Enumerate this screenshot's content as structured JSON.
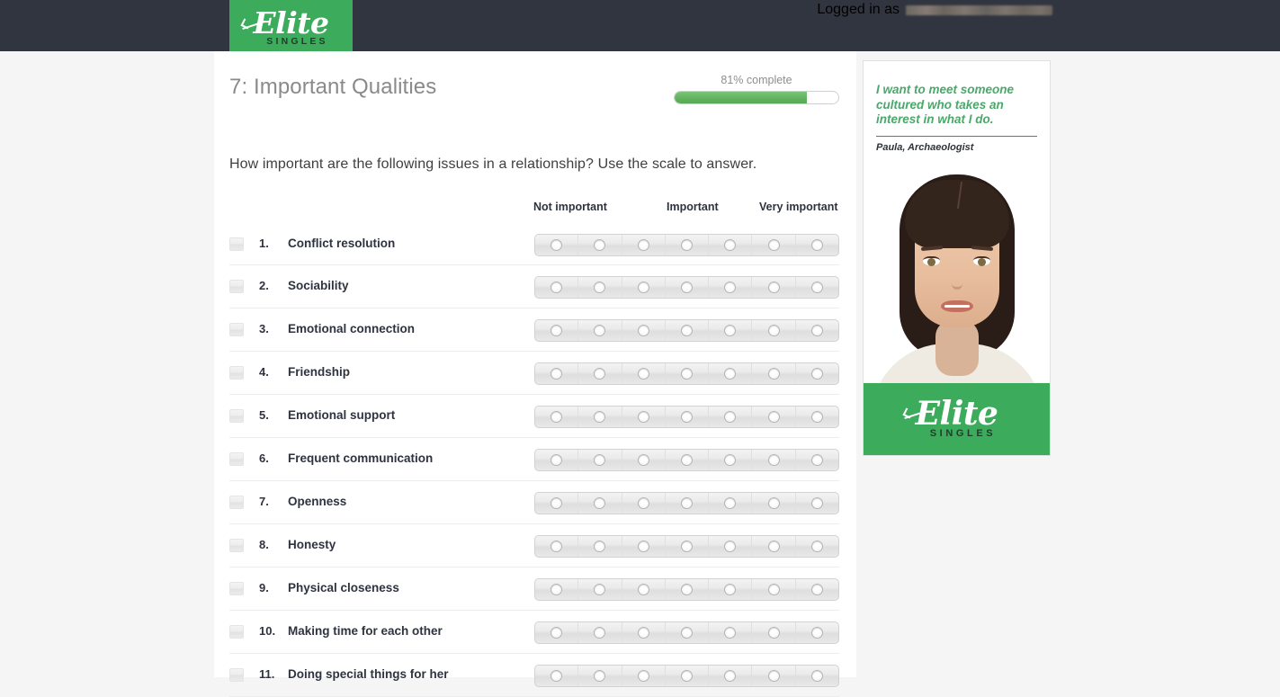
{
  "topbar": {
    "logged_in_label": "Logged in as",
    "logged_in_email": "",
    "background_color": "#31353f"
  },
  "brand": {
    "name": "Elite",
    "subtitle": "SINGLES",
    "green": "#3cab5c"
  },
  "page": {
    "title": "7: Important Qualities",
    "question": "How important are the following issues in a relationship? Use the scale to answer."
  },
  "progress": {
    "label": "81% complete",
    "percent": 81,
    "fill_color": "#63b45f"
  },
  "scale": {
    "headers": [
      "Not important",
      "Important",
      "Very important"
    ],
    "points": 7
  },
  "items": [
    {
      "number": "1.",
      "label": "Conflict resolution"
    },
    {
      "number": "2.",
      "label": "Sociability"
    },
    {
      "number": "3.",
      "label": "Emotional connection"
    },
    {
      "number": "4.",
      "label": "Friendship"
    },
    {
      "number": "5.",
      "label": "Emotional support"
    },
    {
      "number": "6.",
      "label": "Frequent communication"
    },
    {
      "number": "7.",
      "label": "Openness"
    },
    {
      "number": "8.",
      "label": "Honesty"
    },
    {
      "number": "9.",
      "label": "Physical closeness"
    },
    {
      "number": "10.",
      "label": "Making time for each other"
    },
    {
      "number": "11.",
      "label": "Doing special things for her"
    }
  ],
  "ad": {
    "quote": "I want to meet someone cultured who takes an interest in what I do.",
    "attribution": "Paula, Archaeologist",
    "logo_name": "Elite",
    "logo_subtitle": "SINGLES",
    "accent_color": "#4aa86a"
  }
}
